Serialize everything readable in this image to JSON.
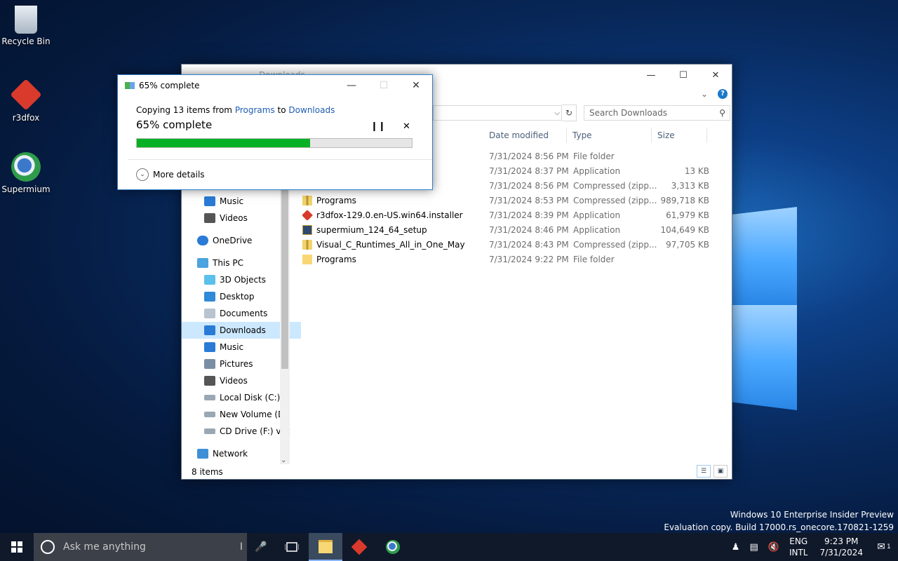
{
  "colors": {
    "accent": "#1979ca",
    "progress": "#06b025",
    "selection": "#cce8ff"
  },
  "desktop": {
    "icons": [
      {
        "label": "Recycle Bin",
        "icon": "recycle-bin-icon"
      },
      {
        "label": "r3dfox",
        "icon": "r3dfox-icon"
      },
      {
        "label": "Supermium",
        "icon": "supermium-icon"
      }
    ]
  },
  "explorer": {
    "title": "Downloads",
    "search_placeholder": "Search Downloads",
    "columns": {
      "date": "Date modified",
      "type": "Type",
      "size": "Size"
    },
    "nav": [
      {
        "label": "Music",
        "indent": 1
      },
      {
        "label": "Videos",
        "indent": 1
      },
      {
        "label": "OneDrive",
        "indent": 0
      },
      {
        "label": "This PC",
        "indent": 0
      },
      {
        "label": "3D Objects",
        "indent": 1
      },
      {
        "label": "Desktop",
        "indent": 1
      },
      {
        "label": "Documents",
        "indent": 1
      },
      {
        "label": "Downloads",
        "indent": 1,
        "selected": true
      },
      {
        "label": "Music",
        "indent": 1
      },
      {
        "label": "Pictures",
        "indent": 1
      },
      {
        "label": "Videos",
        "indent": 1
      },
      {
        "label": "Local Disk (C:)",
        "indent": 1
      },
      {
        "label": "New Volume (D:",
        "indent": 1
      },
      {
        "label": "CD Drive (F:) virt",
        "indent": 1
      },
      {
        "label": "Network",
        "indent": 0
      }
    ],
    "files": [
      {
        "name": "",
        "date": "7/31/2024 8:56 PM",
        "type": "File folder",
        "size": ""
      },
      {
        "name": "",
        "date": "7/31/2024 8:37 PM",
        "type": "Application",
        "size": "13 KB"
      },
      {
        "name": "",
        "date": "7/31/2024 8:56 PM",
        "type": "Compressed (zipp...",
        "size": "3,313 KB"
      },
      {
        "name": "Programs",
        "date": "7/31/2024 8:53 PM",
        "type": "Compressed (zipp...",
        "size": "989,718 KB"
      },
      {
        "name": "r3dfox-129.0.en-US.win64.installer",
        "date": "7/31/2024 8:39 PM",
        "type": "Application",
        "size": "61,979 KB"
      },
      {
        "name": "supermium_124_64_setup",
        "date": "7/31/2024 8:46 PM",
        "type": "Application",
        "size": "104,649 KB"
      },
      {
        "name": "Visual_C_Runtimes_All_in_One_May",
        "date": "7/31/2024 8:43 PM",
        "type": "Compressed (zipp...",
        "size": "97,705 KB"
      },
      {
        "name": "Programs",
        "date": "7/31/2024 9:22 PM",
        "type": "File folder",
        "size": ""
      }
    ],
    "status": "8 items"
  },
  "copy_dialog": {
    "title": "65% complete",
    "copying_prefix": "Copying 13 items from",
    "source": "Programs",
    "to_word": "to",
    "destination": "Downloads",
    "percent_text": "65% complete",
    "progress": 0.63,
    "more_details": "More details"
  },
  "watermark": {
    "line1": "Windows 10 Enterprise Insider Preview",
    "line2": "Evaluation copy. Build 17000.rs_onecore.170821-1259"
  },
  "taskbar": {
    "search_placeholder": "Ask me anything",
    "lang_top": "ENG",
    "lang_bottom": "INTL",
    "time": "9:23 PM",
    "date": "7/31/2024",
    "notification_count": "1"
  }
}
